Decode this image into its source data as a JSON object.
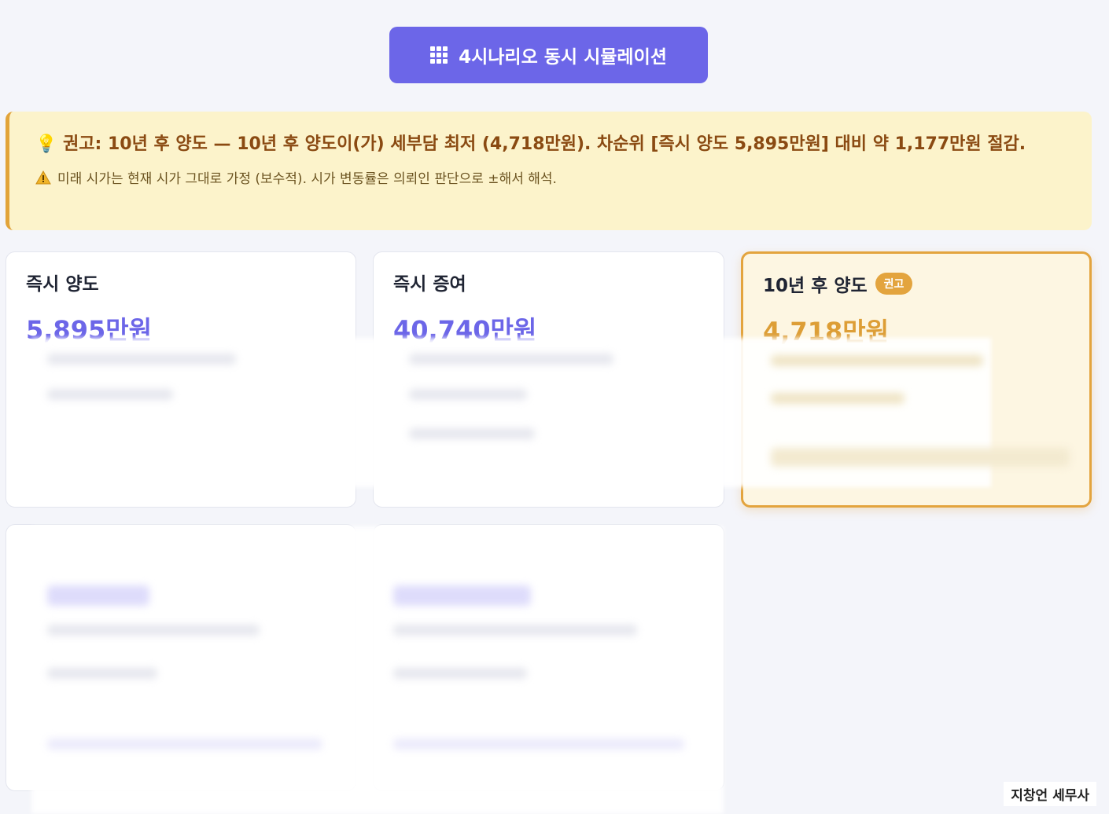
{
  "header": {
    "simulate_button_label": "4시나리오 동시 시뮬레이션"
  },
  "advice": {
    "main_text": "💡 권고: 10년 후 양도 — 10년 후 양도이(가) 세부담 최저 (4,718만원). 차순위 [즉시 양도 5,895만원] 대비 약 1,177만원 절감.",
    "note_text": "미래 시가는 현재 시가 그대로 가정 (보수적). 시가 변동률은 의뢰인 판단으로 ±해서 해석."
  },
  "scenarios": [
    {
      "title": "즉시 양도",
      "amount": "5,895만원",
      "badge": ""
    },
    {
      "title": "즉시 증여",
      "amount": "40,740만원",
      "badge": ""
    },
    {
      "title": "10년 후 양도",
      "amount": "4,718만원",
      "badge": "권고"
    }
  ],
  "colors": {
    "accent": "#6c66e8",
    "recommend": "#e3a43e",
    "advice_bg": "#fcf3cb"
  },
  "watermark": "지창언 세무사"
}
